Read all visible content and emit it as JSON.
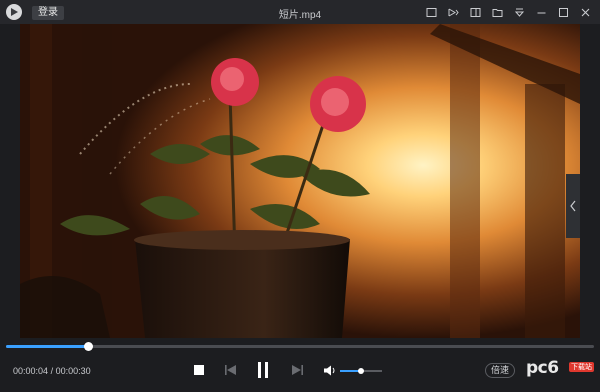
{
  "app": {
    "login_label": "登录",
    "title": "短片.mp4"
  },
  "titlebar_icons": [
    "window-mode-icon",
    "cast-icon",
    "playlist-icon",
    "folder-icon",
    "menu-dropdown-icon",
    "minimize-icon",
    "maximize-icon",
    "close-icon"
  ],
  "player": {
    "current_time": "00:00:04",
    "separator": "/",
    "total_time": "00:00:30",
    "progress": 0.14,
    "volume": 0.5,
    "speed_label": "倍速",
    "is_playing": true
  },
  "watermark": {
    "text": "pc6",
    "tag": "下载站"
  },
  "colors": {
    "accent": "#3aa0ff",
    "background": "#1c1d20"
  }
}
